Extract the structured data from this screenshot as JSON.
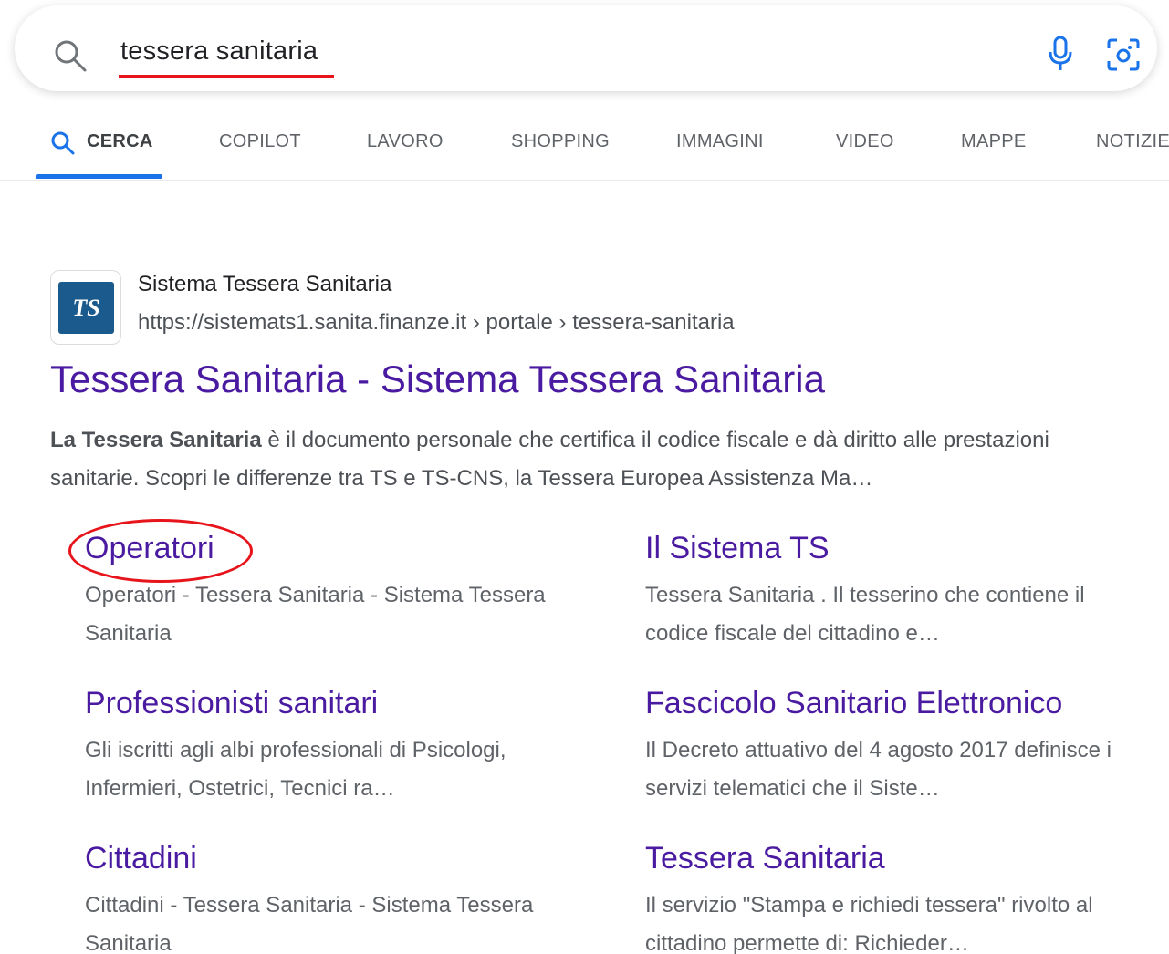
{
  "search": {
    "query": "tessera sanitaria"
  },
  "tabs": [
    {
      "label": "CERCA"
    },
    {
      "label": "COPILOT"
    },
    {
      "label": "LAVORO"
    },
    {
      "label": "SHOPPING"
    },
    {
      "label": "IMMAGINI"
    },
    {
      "label": "VIDEO"
    },
    {
      "label": "MAPPE"
    },
    {
      "label": "NOTIZIE"
    }
  ],
  "result": {
    "favicon_text": "TS",
    "site_name": "Sistema Tessera Sanitaria",
    "url": "https://sistemats1.sanita.finanze.it › portale › tessera-sanitaria",
    "title": "Tessera Sanitaria - Sistema Tessera Sanitaria",
    "snippet_bold": "La Tessera Sanitaria",
    "snippet_rest": " è il documento personale che certifica il codice fiscale e dà diritto alle prestazioni sanitarie. Scopri le differenze tra TS e TS-CNS, la Tessera Europea Assistenza Ma…",
    "sitelinks": [
      {
        "title": "Operatori",
        "desc": "Operatori - Tessera Sanitaria - Sistema Tessera Sanitaria"
      },
      {
        "title": "Il Sistema TS",
        "desc": "Tessera Sanitaria . Il tesserino che contiene il codice fiscale del cittadino e…"
      },
      {
        "title": "Professionisti sanitari",
        "desc": "Gli iscritti agli albi professionali di Psicologi, Infermieri, Ostetrici, Tecnici ra…"
      },
      {
        "title": "Fascicolo Sanitario Elettronico",
        "desc": "Il Decreto attuativo del 4 agosto 2017 definisce i servizi telematici che il Siste…"
      },
      {
        "title": "Cittadini",
        "desc": "Cittadini - Tessera Sanitaria - Sistema Tessera Sanitaria"
      },
      {
        "title": "Tessera Sanitaria",
        "desc": "Il servizio \"Stampa e richiedi tessera\" rivolto al cittadino permette di: Richieder…"
      }
    ]
  },
  "colors": {
    "link": "#4a1ba1",
    "accent": "#1a73e8",
    "annotation": "#e8141b"
  }
}
